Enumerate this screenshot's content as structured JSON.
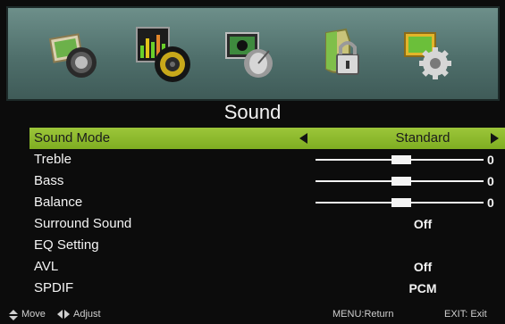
{
  "icon_bar": {
    "items": [
      {
        "name": "picture-icon",
        "selected": false
      },
      {
        "name": "sound-icon",
        "selected": true
      },
      {
        "name": "channel-icon",
        "selected": false
      },
      {
        "name": "lock-icon",
        "selected": false
      },
      {
        "name": "setup-icon",
        "selected": false
      }
    ]
  },
  "page_title": "Sound",
  "menu": {
    "sound_mode": {
      "label": "Sound Mode",
      "value": "Standard"
    },
    "treble": {
      "label": "Treble",
      "value": "0"
    },
    "bass": {
      "label": "Bass",
      "value": "0"
    },
    "balance": {
      "label": "Balance",
      "value": "0"
    },
    "surround": {
      "label": "Surround Sound",
      "value": "Off"
    },
    "eq": {
      "label": "EQ Setting"
    },
    "avl": {
      "label": "AVL",
      "value": "Off"
    },
    "spdif": {
      "label": "SPDIF",
      "value": "PCM"
    }
  },
  "hints": {
    "move": "Move",
    "adjust": "Adjust",
    "return": "MENU:Return",
    "exit": "EXIT: Exit"
  },
  "colors": {
    "highlight": "#8dbb2c",
    "background": "#0c0c0c",
    "icon_bar": "#5a7b77"
  }
}
